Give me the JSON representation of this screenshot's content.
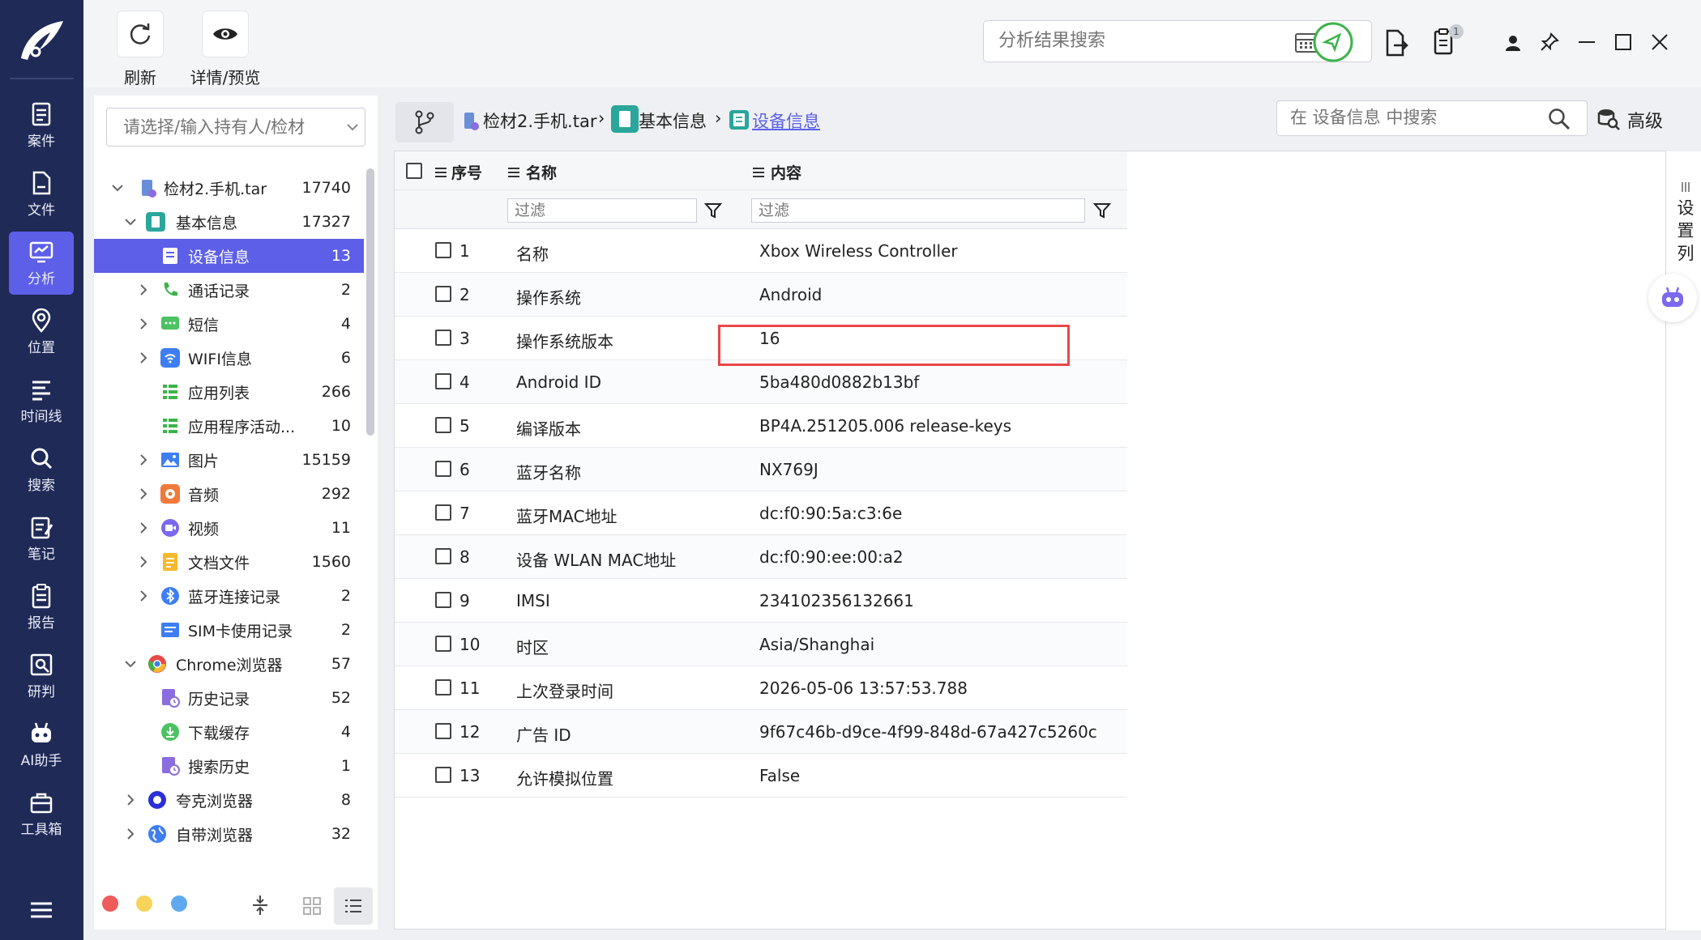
{
  "toolbar": {
    "refresh_label": "刷新",
    "detail_label": "详情/预览",
    "search_placeholder": "分析结果搜索",
    "clipboard_badge": "1"
  },
  "nav": {
    "items": [
      {
        "label": "案件",
        "icon": "case-icon"
      },
      {
        "label": "文件",
        "icon": "file-icon"
      },
      {
        "label": "分析",
        "icon": "analysis-icon"
      },
      {
        "label": "位置",
        "icon": "location-icon"
      },
      {
        "label": "时间线",
        "icon": "timeline-icon"
      },
      {
        "label": "搜索",
        "icon": "search-icon"
      },
      {
        "label": "笔记",
        "icon": "note-icon"
      },
      {
        "label": "报告",
        "icon": "report-icon"
      },
      {
        "label": "研判",
        "icon": "judge-icon"
      },
      {
        "label": "AI助手",
        "icon": "robot-icon"
      },
      {
        "label": "工具箱",
        "icon": "toolbox-icon"
      }
    ],
    "active": "分析"
  },
  "tree": {
    "select_placeholder": "请选择/输入持有人/检材",
    "rows": [
      {
        "label": "检材2.手机.tar",
        "count": "17740"
      },
      {
        "label": "基本信息",
        "count": "17327"
      },
      {
        "label": "设备信息",
        "count": "13"
      },
      {
        "label": "通话记录",
        "count": "2"
      },
      {
        "label": "短信",
        "count": "4"
      },
      {
        "label": "WIFI信息",
        "count": "6"
      },
      {
        "label": "应用列表",
        "count": "266"
      },
      {
        "label": "应用程序活动...",
        "count": "10"
      },
      {
        "label": "图片",
        "count": "15159"
      },
      {
        "label": "音频",
        "count": "292"
      },
      {
        "label": "视频",
        "count": "11"
      },
      {
        "label": "文档文件",
        "count": "1560"
      },
      {
        "label": "蓝牙连接记录",
        "count": "2"
      },
      {
        "label": "SIM卡使用记录",
        "count": "2"
      },
      {
        "label": "Chrome浏览器",
        "count": "57"
      },
      {
        "label": "历史记录",
        "count": "52"
      },
      {
        "label": "下载缓存",
        "count": "4"
      },
      {
        "label": "搜索历史",
        "count": "1"
      },
      {
        "label": "夸克浏览器",
        "count": "8"
      },
      {
        "label": "自带浏览器",
        "count": "32"
      }
    ]
  },
  "breadcrumb": {
    "items": [
      "检材2.手机.tar",
      "基本信息",
      "设备信息"
    ],
    "search_placeholder": "在 设备信息 中搜索",
    "advanced_label": "高级"
  },
  "grid": {
    "headers": {
      "index": "序号",
      "name": "名称",
      "content": "内容"
    },
    "filter_placeholder": "过滤",
    "settings_label": "设置列",
    "rows": [
      {
        "idx": "1",
        "name": "名称",
        "content": "Xbox Wireless Controller"
      },
      {
        "idx": "2",
        "name": "操作系统",
        "content": "Android"
      },
      {
        "idx": "3",
        "name": "操作系统版本",
        "content": "16"
      },
      {
        "idx": "4",
        "name": "Android ID",
        "content": "5ba480d0882b13bf"
      },
      {
        "idx": "5",
        "name": "编译版本",
        "content": "BP4A.251205.006 release-keys"
      },
      {
        "idx": "6",
        "name": "蓝牙名称",
        "content": "NX769J"
      },
      {
        "idx": "7",
        "name": "蓝牙MAC地址",
        "content": "dc:f0:90:5a:c3:6e"
      },
      {
        "idx": "8",
        "name": "设备 WLAN MAC地址",
        "content": "dc:f0:90:ee:00:a2"
      },
      {
        "idx": "9",
        "name": "IMSI",
        "content": "234102356132661"
      },
      {
        "idx": "10",
        "name": "时区",
        "content": "Asia/Shanghai"
      },
      {
        "idx": "11",
        "name": "上次登录时间",
        "content": "2026-05-06 13:57:53.788"
      },
      {
        "idx": "12",
        "name": "广告 ID",
        "content": "9f67c46b-d9ce-4f99-848d-67a427c5260c"
      },
      {
        "idx": "13",
        "name": "允许模拟位置",
        "content": "False"
      }
    ]
  },
  "colors": {
    "nav_bg": "#1f2a57",
    "accent": "#5d5fe8",
    "highlight_border": "#e94848"
  }
}
